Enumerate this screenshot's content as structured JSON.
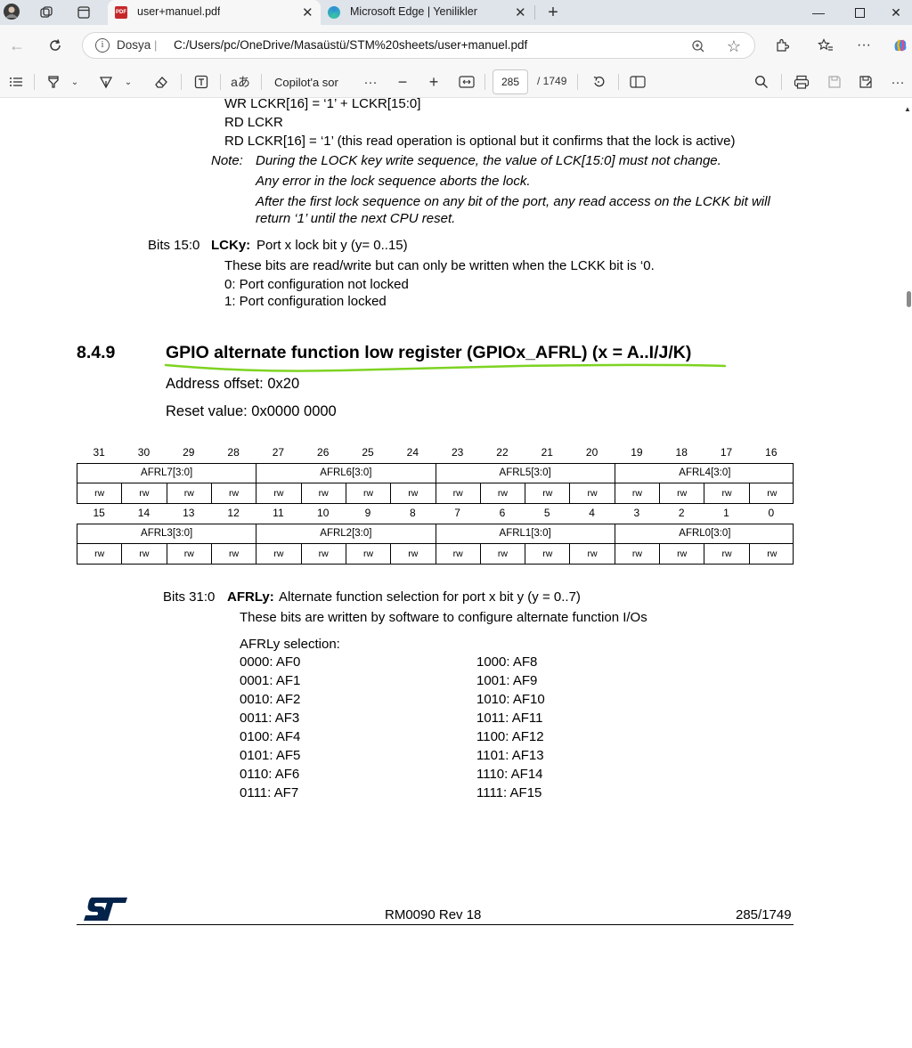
{
  "browser": {
    "tabs": [
      {
        "title": "user+manuel.pdf",
        "active": true,
        "icon": "pdf-icon"
      },
      {
        "title": "Microsoft Edge | Yenilikler",
        "active": false,
        "icon": "edge-icon"
      }
    ],
    "address": {
      "scheme_label": "Dosya",
      "url": "C:/Users/pc/OneDrive/Masaüstü/STM%20sheets/user+manuel.pdf"
    }
  },
  "pdf_toolbar": {
    "copilot_label": "Copilot'a sor",
    "page_current": "285",
    "page_total": "/ 1749"
  },
  "doc": {
    "top_lines": [
      "WR LCKR[16] = ‘1’ + LCKR[15:0]",
      "RD LCKR",
      "RD LCKR[16] = ‘1’ (this read operation is optional but it confirms that the lock is active)"
    ],
    "note_label": "Note:",
    "note_lines": [
      "During the LOCK key write sequence, the value of LCK[15:0] must not change.",
      "Any error in the lock sequence aborts the lock.",
      "After the first lock sequence on any bit of the port, any read access on the LCKK bit will",
      "return ‘1’ until the next CPU reset."
    ],
    "bits15_label": "Bits 15:0",
    "bits15_field": "LCKy:",
    "bits15_desc": "Port x lock bit y (y= 0..15)",
    "bits15_lines": [
      "These bits are read/write but can only be written when the LCKK bit is ‘0.",
      "0: Port configuration not locked",
      "1: Port configuration locked"
    ],
    "section_number": "8.4.9",
    "section_title": "GPIO alternate function low register (GPIOx_AFRL) (x = A..I/J/K)",
    "address_offset": "Address offset: 0x20",
    "reset_value": "Reset value: 0x0000 0000",
    "register": {
      "upper_bits": [
        "31",
        "30",
        "29",
        "28",
        "27",
        "26",
        "25",
        "24",
        "23",
        "22",
        "21",
        "20",
        "19",
        "18",
        "17",
        "16"
      ],
      "upper_fields": [
        "AFRL7[3:0]",
        "AFRL6[3:0]",
        "AFRL5[3:0]",
        "AFRL4[3:0]"
      ],
      "lower_bits": [
        "15",
        "14",
        "13",
        "12",
        "11",
        "10",
        "9",
        "8",
        "7",
        "6",
        "5",
        "4",
        "3",
        "2",
        "1",
        "0"
      ],
      "lower_fields": [
        "AFRL3[3:0]",
        "AFRL2[3:0]",
        "AFRL1[3:0]",
        "AFRL0[3:0]"
      ],
      "access": "rw"
    },
    "bits31_label": "Bits 31:0",
    "bits31_field": "AFRLy:",
    "bits31_desc": "Alternate function selection for port x bit y (y = 0..7)",
    "bits31_line": "These bits are written by software to configure alternate function I/Os",
    "selection_label": "AFRLy selection:",
    "selection_left": [
      "0000: AF0",
      "0001: AF1",
      "0010: AF2",
      "0011: AF3",
      "0100: AF4",
      "0101: AF5",
      "0110: AF6",
      "0111: AF7"
    ],
    "selection_right": [
      "1000: AF8",
      "1001: AF9",
      "1010: AF10",
      "1011: AF11",
      "1100: AF12",
      "1101: AF13",
      "1110: AF14",
      "1111: AF15"
    ],
    "footer_doc": "RM0090 Rev 18",
    "footer_page": "285/1749"
  },
  "colors": {
    "underline_annotation": "#7ed321",
    "st_logo": "#03234b"
  }
}
